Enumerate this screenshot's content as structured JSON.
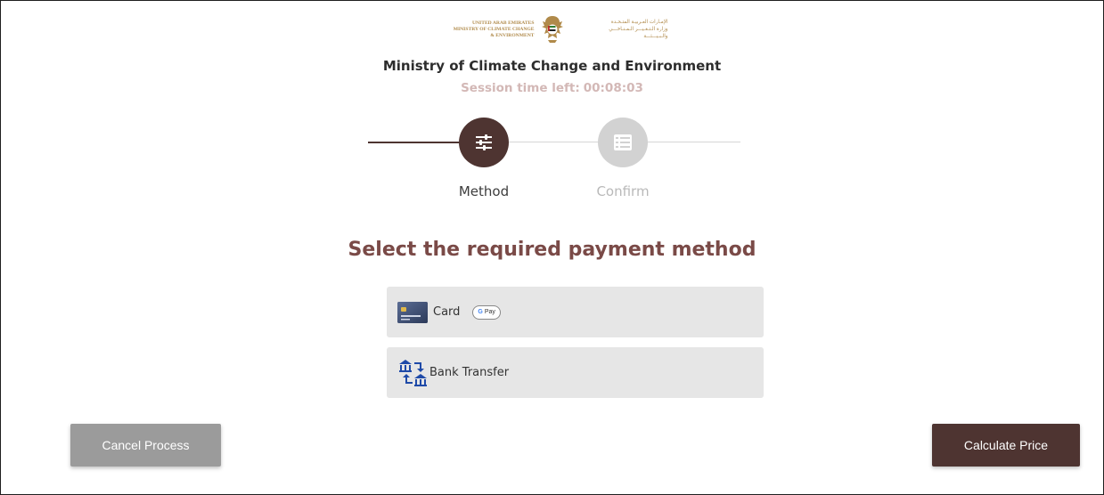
{
  "header": {
    "logo_en_line1": "UNITED ARAB EMIRATES",
    "logo_en_line2": "MINISTRY OF CLIMATE CHANGE",
    "logo_en_line3": "& ENVIRONMENT",
    "logo_ar_line1": "الإمـارات العـربيـة المتـحـدة",
    "logo_ar_line2": "وزارة الـتـغـيـــر الـمـنـاخـــي",
    "logo_ar_line3": "والـبـيـــئـــة",
    "ministry_title": "Ministry of Climate Change and Environment",
    "session_label": "Session time left:",
    "session_time": "00:08:03"
  },
  "stepper": {
    "steps": [
      {
        "label": "Method",
        "icon": "sliders-icon",
        "active": true
      },
      {
        "label": "Confirm",
        "icon": "list-icon",
        "active": false
      }
    ]
  },
  "payment": {
    "title": "Select the required payment method",
    "options": [
      {
        "label": "Card",
        "icon": "credit-card-icon",
        "badge": "Pay",
        "badge_prefix": "G"
      },
      {
        "label": "Bank Transfer",
        "icon": "bank-transfer-icon"
      }
    ]
  },
  "actions": {
    "cancel_label": "Cancel Process",
    "calculate_label": "Calculate Price"
  },
  "colors": {
    "primary": "#4e3431",
    "title_accent": "#7a4a47",
    "session_text": "#d3b8b6",
    "inactive_step": "#d2d2d2",
    "option_bg": "#e6e6e6",
    "cancel_bg": "#9b9b9b"
  }
}
